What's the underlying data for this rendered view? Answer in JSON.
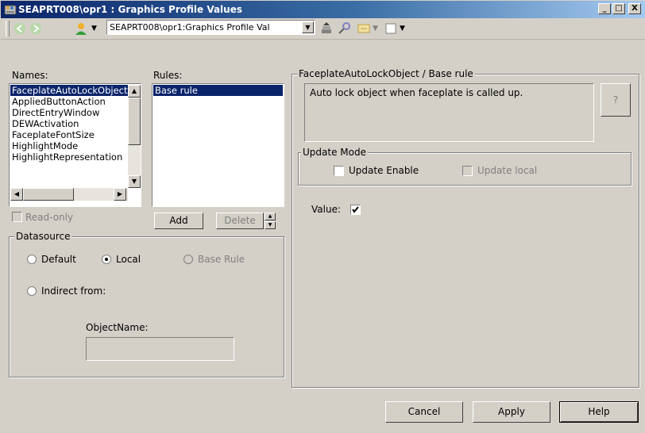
{
  "window": {
    "title": "SEAPRT008\\opr1 : Graphics Profile Values",
    "minimize": "_",
    "maximize": "□",
    "close": "X"
  },
  "toolbar": {
    "combo_value": "SEAPRT008\\opr1:Graphics Profile Val"
  },
  "names": {
    "label": "Names:",
    "items": [
      "FaceplateAutoLockObject",
      "AppliedButtonAction",
      "DirectEntryWindow",
      "DEWActivation",
      "FaceplateFontSize",
      "HighlightMode",
      "HighlightRepresentation"
    ],
    "selected_index": 0
  },
  "rules": {
    "label": "Rules:",
    "items": [
      "Base rule"
    ],
    "add_label": "Add",
    "delete_label": "Delete"
  },
  "readonly_label": "Read-only",
  "datasource": {
    "title": "Datasource",
    "default_label": "Default",
    "local_label": "Local",
    "base_rule_label": "Base Rule",
    "indirect_label": "Indirect from:",
    "objectname_label": "ObjectName:",
    "objectname_value": ""
  },
  "detail": {
    "title": "FaceplateAutoLockObject / Base rule",
    "description": "Auto lock object when faceplate is called up.",
    "help_btn": "?",
    "update_mode_title": "Update Mode",
    "update_enable_label": "Update Enable",
    "update_local_label": "Update local",
    "value_label": "Value:",
    "value_checked": true
  },
  "footer": {
    "cancel": "Cancel",
    "apply": "Apply",
    "help": "Help"
  }
}
